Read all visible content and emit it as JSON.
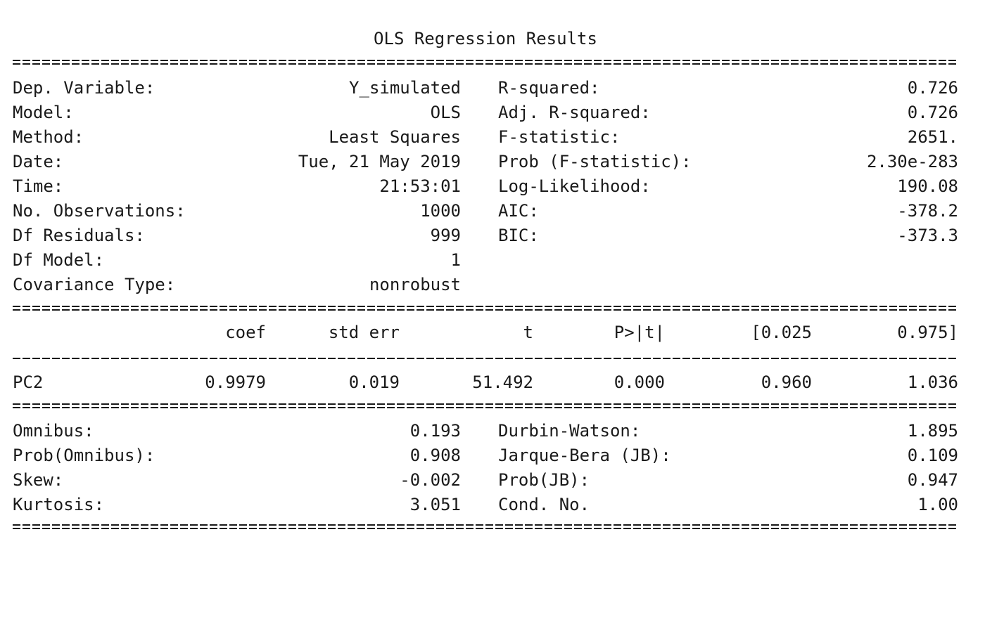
{
  "title": "OLS Regression Results",
  "summary_left": [
    {
      "label": "Dep. Variable:",
      "value": "Y_simulated"
    },
    {
      "label": "Model:",
      "value": "OLS"
    },
    {
      "label": "Method:",
      "value": "Least Squares"
    },
    {
      "label": "Date:",
      "value": "Tue, 21 May 2019"
    },
    {
      "label": "Time:",
      "value": "21:53:01"
    },
    {
      "label": "No. Observations:",
      "value": "1000"
    },
    {
      "label": "Df Residuals:",
      "value": "999"
    },
    {
      "label": "Df Model:",
      "value": "1"
    },
    {
      "label": "Covariance Type:",
      "value": "nonrobust"
    }
  ],
  "summary_right": [
    {
      "label": "R-squared:",
      "value": "0.726"
    },
    {
      "label": "Adj. R-squared:",
      "value": "0.726"
    },
    {
      "label": "F-statistic:",
      "value": "2651."
    },
    {
      "label": "Prob (F-statistic):",
      "value": "2.30e-283"
    },
    {
      "label": "Log-Likelihood:",
      "value": "190.08"
    },
    {
      "label": "AIC:",
      "value": "-378.2"
    },
    {
      "label": "BIC:",
      "value": "-373.3"
    }
  ],
  "coef_table": {
    "headers": [
      "coef",
      "std err",
      "t",
      "P>|t|",
      "[0.025",
      "0.975]"
    ],
    "rows": [
      {
        "name": "PC2",
        "values": [
          "0.9979",
          "0.019",
          "51.492",
          "0.000",
          "0.960",
          "1.036"
        ]
      }
    ]
  },
  "diagnostics_left": [
    {
      "label": "Omnibus:",
      "value": "0.193"
    },
    {
      "label": "Prob(Omnibus):",
      "value": "0.908"
    },
    {
      "label": "Skew:",
      "value": "-0.002"
    },
    {
      "label": "Kurtosis:",
      "value": "3.051"
    }
  ],
  "diagnostics_right": [
    {
      "label": "Durbin-Watson:",
      "value": "1.895"
    },
    {
      "label": "Jarque-Bera (JB):",
      "value": "0.109"
    },
    {
      "label": "Prob(JB):",
      "value": "0.947"
    },
    {
      "label": "Cond. No.",
      "value": "1.00"
    }
  ]
}
